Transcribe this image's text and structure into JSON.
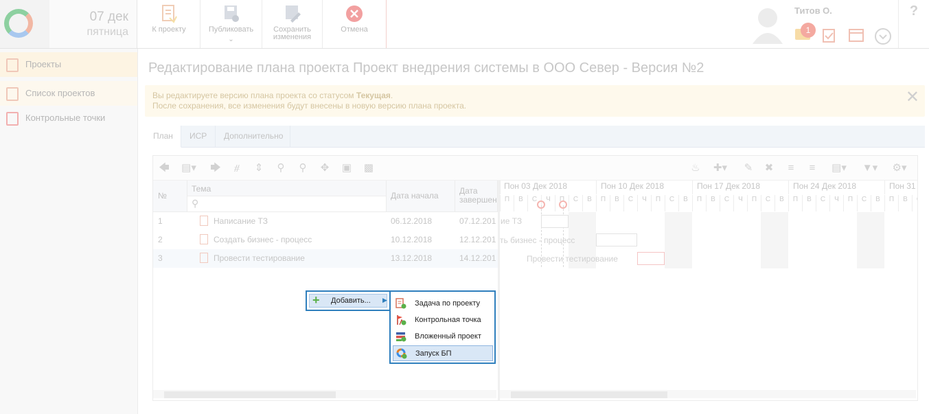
{
  "header": {
    "date_day": "07 дек",
    "date_weekday": "пятница",
    "toolbar": {
      "to_project": "К проекту",
      "publish": "Публиковать",
      "save_line1": "Сохранить",
      "save_line2": "изменения",
      "cancel": "Отмена"
    },
    "user_name": "Титов О.",
    "notification_count": "1",
    "help": "?"
  },
  "sidebar": {
    "items": [
      {
        "label": "Проекты"
      },
      {
        "label": "Список проектов"
      },
      {
        "label": "Контрольные точки"
      }
    ]
  },
  "page": {
    "title": "Редактирование плана проекта Проект внедрения системы в ООО Север - Версия №2",
    "notice_prefix": "Вы редактируете версию плана проекта со статусом ",
    "notice_status": "Текущая",
    "notice_suffix": ".",
    "notice_line2": "После сохранения, все изменения будут внесены в новую версию плана проекта."
  },
  "tabs": [
    {
      "label": "План"
    },
    {
      "label": "ИСР"
    },
    {
      "label": "Дополнительно"
    }
  ],
  "grid": {
    "columns": {
      "num": "№",
      "topic": "Тема",
      "start": "Дата начала",
      "end_line1": "Дата",
      "end_line2": "завершен"
    },
    "rows": [
      {
        "num": "1",
        "topic": "Написание ТЗ",
        "start": "06.12.2018",
        "end": "07.12.201"
      },
      {
        "num": "2",
        "topic": "Создать бизнес - процесс",
        "start": "10.12.2018",
        "end": "12.12.201"
      },
      {
        "num": "3",
        "topic": "Провести тестирование",
        "start": "13.12.2018",
        "end": "14.12.201"
      }
    ]
  },
  "gantt": {
    "weeks": [
      "Пон 03 Дек 2018",
      "Пон 10 Дек 2018",
      "Пон 17 Дек 2018",
      "Пон 24 Дек 2018",
      "Пон 31"
    ],
    "days": [
      "П",
      "В",
      "С",
      "Ч",
      "П",
      "С",
      "В"
    ],
    "bar_labels": [
      "ие ТЗ",
      "ть бизнес - процесс",
      "Провести тестирование"
    ]
  },
  "context_menu": {
    "add_label": "Добавить...",
    "items": [
      {
        "label": "Задача по проекту",
        "icon": "task-icon"
      },
      {
        "label": "Контрольная точка",
        "icon": "milestone-icon"
      },
      {
        "label": "Вложенный проект",
        "icon": "subproject-icon"
      },
      {
        "label": "Запуск БП",
        "icon": "bp-launch-icon"
      }
    ]
  },
  "colors": {
    "menu_border": "#2f7fbd",
    "menu_highlight": "#d9e7f6",
    "notice_bg": "#fef9ec"
  }
}
